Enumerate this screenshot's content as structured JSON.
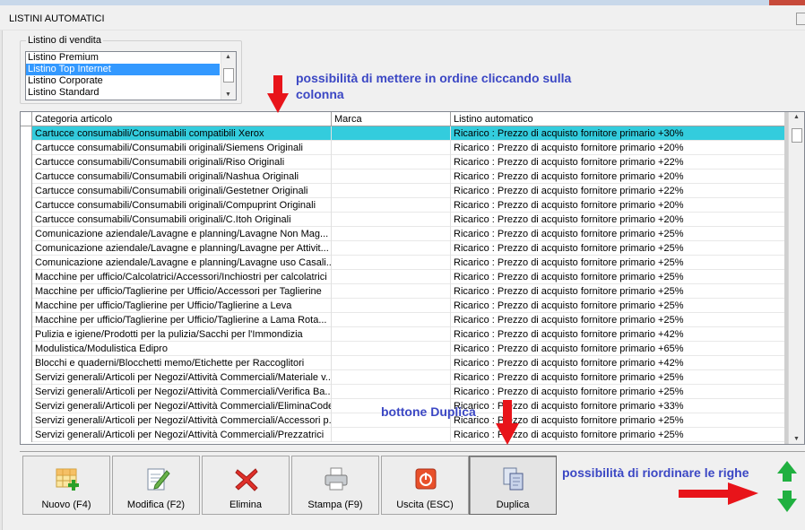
{
  "window": {
    "title": "LISTINI AUTOMATICI"
  },
  "listino": {
    "legend": "Listino di vendita",
    "items": [
      "Listino Premium",
      "Listino Top Internet",
      "Listino Corporate",
      "Listino Standard"
    ],
    "selected_index": 1
  },
  "annotations": {
    "sort_line1": "possibilità di mettere in ordine cliccando sulla",
    "sort_line2": "colonna",
    "duplica": "bottone Duplica",
    "reorder": "possibilità di riordinare le righe"
  },
  "grid": {
    "columns": [
      "Categoria articolo",
      "Marca",
      "Listino automatico"
    ],
    "selected_index": 0,
    "rows": [
      [
        "Cartucce consumabili/Consumabili compatibili Xerox",
        "",
        "Ricarico : Prezzo di acquisto fornitore primario +30%"
      ],
      [
        "Cartucce consumabili/Consumabili originali/Siemens Originali",
        "",
        "Ricarico : Prezzo di acquisto fornitore primario +20%"
      ],
      [
        "Cartucce consumabili/Consumabili originali/Riso Originali",
        "",
        "Ricarico : Prezzo di acquisto fornitore primario +22%"
      ],
      [
        "Cartucce consumabili/Consumabili originali/Nashua Originali",
        "",
        "Ricarico : Prezzo di acquisto fornitore primario +20%"
      ],
      [
        "Cartucce consumabili/Consumabili originali/Gestetner Originali",
        "",
        "Ricarico : Prezzo di acquisto fornitore primario +22%"
      ],
      [
        "Cartucce consumabili/Consumabili originali/Compuprint Originali",
        "",
        "Ricarico : Prezzo di acquisto fornitore primario +20%"
      ],
      [
        "Cartucce consumabili/Consumabili originali/C.Itoh Originali",
        "",
        "Ricarico : Prezzo di acquisto fornitore primario +20%"
      ],
      [
        "Comunicazione aziendale/Lavagne e planning/Lavagne Non Mag...",
        "",
        "Ricarico : Prezzo di acquisto fornitore primario +25%"
      ],
      [
        "Comunicazione aziendale/Lavagne e planning/Lavagne per Attivit...",
        "",
        "Ricarico : Prezzo di acquisto fornitore primario +25%"
      ],
      [
        "Comunicazione aziendale/Lavagne e planning/Lavagne uso Casali...",
        "",
        "Ricarico : Prezzo di acquisto fornitore primario +25%"
      ],
      [
        "Macchine per ufficio/Calcolatrici/Accessori/Inchiostri per calcolatrici",
        "",
        "Ricarico : Prezzo di acquisto fornitore primario +25%"
      ],
      [
        "Macchine per ufficio/Taglierine per Ufficio/Accessori per Taglierine",
        "",
        "Ricarico : Prezzo di acquisto fornitore primario +25%"
      ],
      [
        "Macchine per ufficio/Taglierine per Ufficio/Taglierine a Leva",
        "",
        "Ricarico : Prezzo di acquisto fornitore primario +25%"
      ],
      [
        "Macchine per ufficio/Taglierine per Ufficio/Taglierine a Lama Rota...",
        "",
        "Ricarico : Prezzo di acquisto fornitore primario +25%"
      ],
      [
        "Pulizia e igiene/Prodotti per la pulizia/Sacchi per l'Immondizia",
        "",
        "Ricarico : Prezzo di acquisto fornitore primario +42%"
      ],
      [
        "Modulistica/Modulistica Edipro",
        "",
        "Ricarico : Prezzo di acquisto fornitore primario +65%"
      ],
      [
        "Blocchi e quaderni/Blocchetti memo/Etichette per Raccoglitori",
        "",
        "Ricarico : Prezzo di acquisto fornitore primario +42%"
      ],
      [
        "Servizi generali/Articoli per Negozi/Attività Commerciali/Materiale v...",
        "",
        "Ricarico : Prezzo di acquisto fornitore primario +25%"
      ],
      [
        "Servizi generali/Articoli per Negozi/Attività Commerciali/Verifica Ba...",
        "",
        "Ricarico : Prezzo di acquisto fornitore primario +25%"
      ],
      [
        "Servizi generali/Articoli per Negozi/Attività Commerciali/EliminaCode",
        "",
        "Ricarico : Prezzo di acquisto fornitore primario +33%"
      ],
      [
        "Servizi generali/Articoli per Negozi/Attività Commerciali/Accessori p...",
        "",
        "Ricarico : Prezzo di acquisto fornitore primario +25%"
      ],
      [
        "Servizi generali/Articoli per Negozi/Attività Commerciali/Prezzatrici",
        "",
        "Ricarico : Prezzo di acquisto fornitore primario +25%"
      ]
    ]
  },
  "toolbar": {
    "nuovo": "Nuovo (F4)",
    "modifica": "Modifica (F2)",
    "elimina": "Elimina",
    "stampa": "Stampa (F9)",
    "uscita": "Uscita (ESC)",
    "duplica": "Duplica"
  },
  "colors": {
    "selected_row": "#33ccdd",
    "list_selection": "#3399ff",
    "annotation_text": "#3b47c4",
    "red_arrow": "#e8141a",
    "green_arrow": "#20b040"
  },
  "icons": [
    "grid-add-icon",
    "edit-pencil-icon",
    "delete-x-icon",
    "printer-icon",
    "exit-power-icon",
    "duplicate-pages-icon"
  ]
}
